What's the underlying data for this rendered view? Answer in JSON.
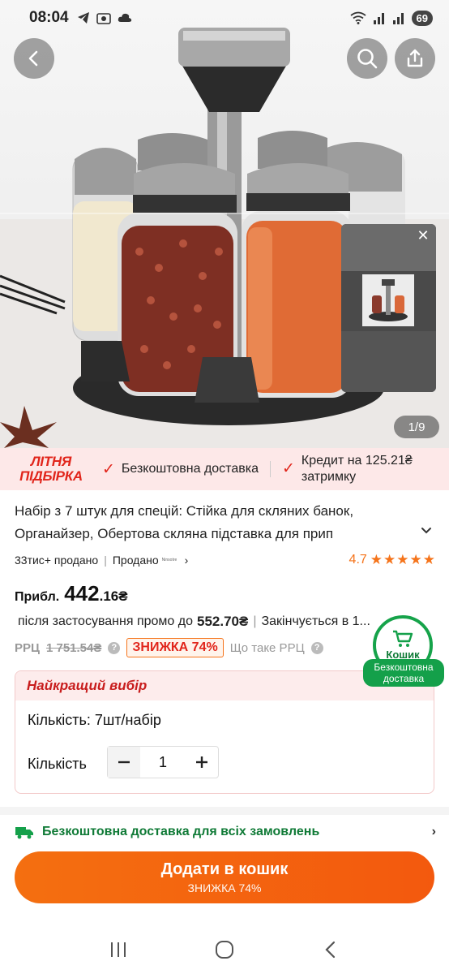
{
  "status_bar": {
    "time": "08:04",
    "battery": "69"
  },
  "hero": {
    "image_counter": "1/9"
  },
  "promo_strip": {
    "summer_line1": "ЛІТНЯ",
    "summer_line2": "ПІДБІРКА",
    "free_delivery": "Безкоштовна доставка",
    "credit": "Кредит на 125.21₴ затримку"
  },
  "product": {
    "title": "Набір з 7 штук для спецій: Стійка для скляних банок, Органайзер, Обертова скляна підставка для прип",
    "sold_count": "33тис+ продано",
    "sold_by_label": "Продано",
    "store_name": "Ninsotre",
    "rating": "4.7",
    "stars": "★★★★★"
  },
  "price": {
    "approx_label": "Прибл.",
    "main": "442",
    "decimals": ".16₴",
    "promo_label": "після застосування промо до",
    "promo_price": "552.70₴",
    "ends_label": "Закінчується в 1...",
    "rrp_label": "РРЦ",
    "rrp_old": "1 751.54₴",
    "discount_badge": "ЗНИЖКА 74%",
    "what_is_rrp": "Що таке РРЦ"
  },
  "cart_float": {
    "label": "Кошик",
    "free_delivery": "Безкоштовна доставка"
  },
  "best_choice": {
    "header": "Найкращий вибір",
    "variant": "Кількість: 7шт/набір",
    "qty_label": "Кількість",
    "qty_value": "1"
  },
  "shipping": {
    "text": "Безкоштовна доставка для всіх замовлень"
  },
  "add_to_cart": {
    "label": "Додати в кошик",
    "sub": "ЗНИЖКА 74%"
  },
  "colors": {
    "accent": "#f46f10",
    "red": "#e1251b",
    "green": "#16a34a"
  }
}
